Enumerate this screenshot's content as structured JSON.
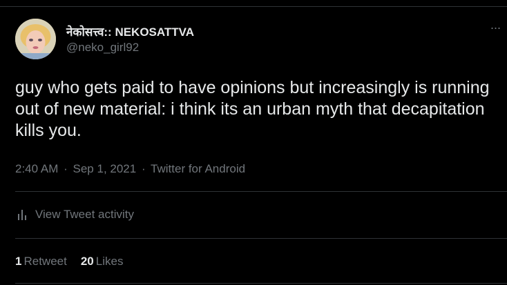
{
  "tweet": {
    "author": {
      "display_name": "नेकोसत्त्व:: NEKOSATTVA",
      "handle": "@neko_girl92"
    },
    "more_label": "···",
    "text": "guy who gets paid to have opinions but increasingly is running out of new material: i think its an urban myth that decapitation kills you.",
    "time": "2:40 AM",
    "date": "Sep 1, 2021",
    "separator": "·",
    "source": "Twitter for Android",
    "activity_label": "View Tweet activity",
    "stats": {
      "retweets_count": "1",
      "retweets_label": "Retweet",
      "likes_count": "20",
      "likes_label": "Likes"
    }
  },
  "colors": {
    "background": "#000000",
    "text_primary": "#e7e9ea",
    "text_secondary": "#71767b",
    "divider": "#2f3336"
  },
  "icons": [
    "avatar-image",
    "more-icon",
    "activity-bars-icon"
  ]
}
